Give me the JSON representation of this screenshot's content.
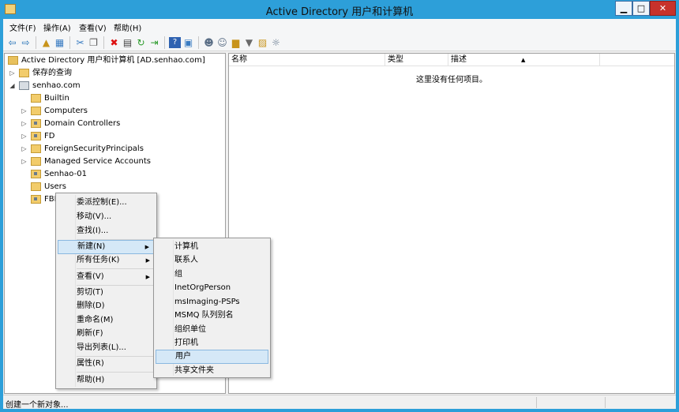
{
  "window": {
    "title": "Active Directory 用户和计算机",
    "minimize": "▁",
    "maximize": "□",
    "close": "✕"
  },
  "menubar": {
    "items": [
      "文件(F)",
      "操作(A)",
      "查看(V)",
      "帮助(H)"
    ]
  },
  "toolbar": {
    "icons": [
      "back-icon",
      "forward-icon",
      "up-icon",
      "show-tree-icon",
      "cut-icon",
      "copy-icon",
      "delete-icon",
      "properties-icon",
      "refresh-icon",
      "export-icon",
      "help-icon",
      "console-icon",
      "new-user-icon",
      "new-group-icon",
      "new-ou-icon",
      "filter-icon",
      "find-icon",
      "add-to-group-icon"
    ]
  },
  "tree": {
    "root": "Active Directory 用户和计算机 [AD.senhao.com]",
    "saved_queries": "保存的查询",
    "domain": "senhao.com",
    "children": [
      "Builtin",
      "Computers",
      "Domain Controllers",
      "FD",
      "ForeignSecurityPrincipals",
      "Managed Service Accounts",
      "Senhao-01",
      "Users",
      "FBI"
    ]
  },
  "details": {
    "columns": [
      "名称",
      "类型",
      "描述"
    ],
    "empty_message": "这里没有任何项目。"
  },
  "context_menu": {
    "items": [
      "委派控制(E)...",
      "移动(V)...",
      "查找(I)...",
      "新建(N)",
      "所有任务(K)",
      "查看(V)",
      "剪切(T)",
      "删除(D)",
      "重命名(M)",
      "刷新(F)",
      "导出列表(L)...",
      "属性(R)",
      "帮助(H)"
    ],
    "highlighted": "新建(N)"
  },
  "submenu": {
    "items": [
      "计算机",
      "联系人",
      "组",
      "InetOrgPerson",
      "msImaging-PSPs",
      "MSMQ 队列别名",
      "组织单位",
      "打印机",
      "用户",
      "共享文件夹"
    ],
    "highlighted": "用户"
  },
  "status": {
    "text": "创建一个新对象..."
  }
}
